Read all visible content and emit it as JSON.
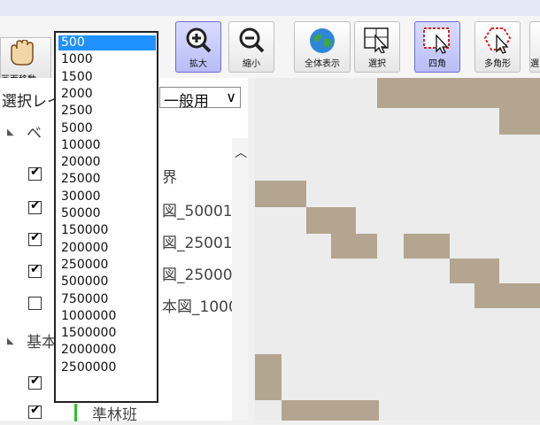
{
  "toolbar": {
    "move_label": "画面移動",
    "buttons": [
      {
        "label": "拡大",
        "icon": "zoom-in-icon",
        "active": true
      },
      {
        "label": "縮小",
        "icon": "zoom-out-icon",
        "active": false
      },
      {
        "label": "全体表示",
        "icon": "globe-icon",
        "active": false
      },
      {
        "label": "選択",
        "icon": "select-arrow-icon",
        "active": false
      },
      {
        "label": "四角",
        "icon": "rectangle-select-icon",
        "active": true
      },
      {
        "label": "多角形",
        "icon": "polygon-select-icon",
        "active": false
      },
      {
        "label": "選",
        "icon": "select-icon",
        "active": false
      }
    ]
  },
  "left_panel": {
    "layer_label": "選択レイヤ",
    "layer_value": "一般用",
    "groups": [
      {
        "label": "ベ"
      },
      {
        "label": "基本"
      }
    ],
    "rows": [
      {
        "checked": true,
        "text": "界"
      },
      {
        "checked": true,
        "text": "図_50001_"
      },
      {
        "checked": true,
        "text": "図_25001_"
      },
      {
        "checked": true,
        "text": "図_25000"
      },
      {
        "checked": false,
        "text": "本図_1000"
      },
      {
        "checked": true,
        "text": ""
      },
      {
        "checked": true,
        "text": "準林班"
      }
    ]
  },
  "scale_dropdown": {
    "selected": "500",
    "options": [
      "500",
      "1000",
      "1500",
      "2000",
      "2500",
      "5000",
      "10000",
      "20000",
      "25000",
      "30000",
      "50000",
      "150000",
      "200000",
      "250000",
      "500000",
      "750000",
      "1000000",
      "1500000",
      "2000000",
      "2500000"
    ]
  },
  "colors": {
    "map_background": "#ececec",
    "map_cell": "#b3a590",
    "selection": "#1e90ff"
  }
}
